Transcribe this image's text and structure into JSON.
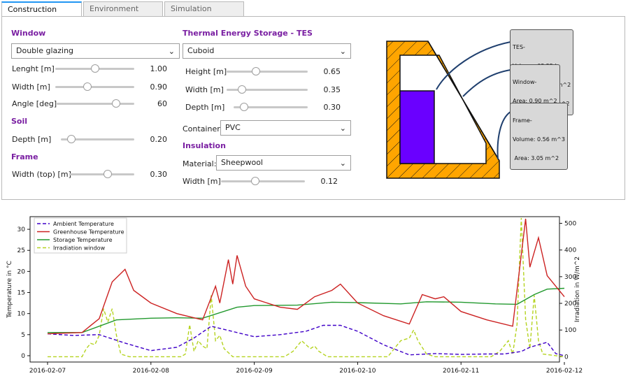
{
  "tabs": [
    {
      "label": "Construction",
      "active": true
    },
    {
      "label": "Environment",
      "active": false
    },
    {
      "label": "Simulation",
      "active": false
    }
  ],
  "window_section": {
    "title": "Window",
    "type": "Double glazing",
    "length_label": "Lenght [m]",
    "length_value": "1.00",
    "length_level": 0.5,
    "width_label": "Width [m]",
    "width_value": "0.90",
    "width_level": 0.4,
    "angle_label": "Angle [deg]",
    "angle_value": "60",
    "angle_level": 0.8
  },
  "soil_section": {
    "title": "Soil",
    "depth_label": "Depth [m]",
    "depth_value": "0.20",
    "depth_level": 0.1
  },
  "frame_section": {
    "title": "Frame",
    "width_label": "Width (top) [m]",
    "width_value": "0.30",
    "width_level": 0.6
  },
  "tes_section": {
    "title": "Thermal Energy Storage - TES",
    "shape": "Cuboid",
    "height_label": "Height [m]",
    "height_value": "0.65",
    "height_level": 0.35,
    "width_label": "Width [m]",
    "width_value": "0.35",
    "width_level": 0.15,
    "depth_label": "Depth [m]",
    "depth_value": "0.30",
    "depth_level": 0.1,
    "container_label": "Container:",
    "container_value": "PVC"
  },
  "insulation_section": {
    "title": "Insulation",
    "material_label": "Material:",
    "material_value": "Sheepwool",
    "width_label": "Width [m]",
    "width_value": "0.12",
    "width_level": 0.4
  },
  "diagram": {
    "tes_callout": [
      "TES-",
      "Volume: 68.25 L",
      "Area-abs.: 0.23 m^2",
      "Area-emi.:0.72 m^2"
    ],
    "window_callout": [
      "Window-",
      "Area: 0.90 m^2"
    ],
    "frame_callout": [
      "Frame-",
      "Volume: 0.56 m^3",
      " Area: 3.05 m^2"
    ],
    "frame_color": "#ffa500",
    "tes_color": "#6a00ff"
  },
  "chart_data": {
    "type": "line",
    "ylabel": "Temperature in °C",
    "y2label": "Irradiation in W/m^2",
    "ylim": [
      -1.5,
      33
    ],
    "y2lim": [
      -20,
      525
    ],
    "yticks": [
      0,
      5,
      10,
      15,
      20,
      25,
      30
    ],
    "y2ticks": [
      0,
      100,
      200,
      300,
      400,
      500
    ],
    "xlim": [
      "2016-02-07",
      "2016-02-12"
    ],
    "xticks": [
      "2016-02-07",
      "2016-02-08",
      "2016-02-09",
      "2016-02-10",
      "2016-02-11",
      "2016-02-12"
    ],
    "legend_position": "top-left",
    "series": [
      {
        "name": "Ambient Temperature",
        "axis": "left",
        "color": "#3f00c8",
        "style": "dashed",
        "x": [
          "2016-02-07T00:00",
          "2016-02-07T06:00",
          "2016-02-07T12:00",
          "2016-02-07T18:00",
          "2016-02-08T00:00",
          "2016-02-08T06:00",
          "2016-02-08T10:00",
          "2016-02-08T14:00",
          "2016-02-08T16:00",
          "2016-02-08T18:00",
          "2016-02-09T00:00",
          "2016-02-09T06:00",
          "2016-02-09T12:00",
          "2016-02-09T16:00",
          "2016-02-09T20:00",
          "2016-02-10T00:00",
          "2016-02-10T06:00",
          "2016-02-10T12:00",
          "2016-02-10T18:00",
          "2016-02-11T00:00",
          "2016-02-11T06:00",
          "2016-02-11T10:00",
          "2016-02-11T14:00",
          "2016-02-11T16:00",
          "2016-02-11T20:00",
          "2016-02-11T22:00",
          "2016-02-12T00:00"
        ],
        "y": [
          5.2,
          4.8,
          5.0,
          3.0,
          1.2,
          2.0,
          4.2,
          7.0,
          6.5,
          6.0,
          4.5,
          5.0,
          5.8,
          7.2,
          7.2,
          5.8,
          2.6,
          0.2,
          0.5,
          0.3,
          0.4,
          0.4,
          1.0,
          2.0,
          3.2,
          0.5,
          0.0
        ]
      },
      {
        "name": "Greenhouse Temperature",
        "axis": "left",
        "color": "#cc2222",
        "style": "solid",
        "x": [
          "2016-02-07T00:00",
          "2016-02-07T08:00",
          "2016-02-07T12:00",
          "2016-02-07T15:00",
          "2016-02-07T18:00",
          "2016-02-07T20:00",
          "2016-02-08T00:00",
          "2016-02-08T06:00",
          "2016-02-08T12:00",
          "2016-02-08T15:00",
          "2016-02-08T16:00",
          "2016-02-08T18:00",
          "2016-02-08T19:00",
          "2016-02-08T20:00",
          "2016-02-08T22:00",
          "2016-02-09T00:00",
          "2016-02-09T06:00",
          "2016-02-09T10:00",
          "2016-02-09T14:00",
          "2016-02-09T18:00",
          "2016-02-09T20:00",
          "2016-02-10T00:00",
          "2016-02-10T06:00",
          "2016-02-10T12:00",
          "2016-02-10T15:00",
          "2016-02-10T18:00",
          "2016-02-10T20:00",
          "2016-02-11T00:00",
          "2016-02-11T06:00",
          "2016-02-11T12:00",
          "2016-02-11T15:00",
          "2016-02-11T16:00",
          "2016-02-11T18:00",
          "2016-02-11T20:00",
          "2016-02-12T00:00"
        ],
        "y": [
          5.2,
          5.5,
          8.8,
          17.5,
          20.5,
          15.5,
          12.5,
          10.0,
          8.5,
          16.5,
          12.5,
          22.8,
          17.0,
          23.8,
          16.5,
          13.5,
          11.5,
          11.0,
          14.0,
          15.5,
          17.0,
          12.5,
          9.5,
          7.5,
          14.5,
          13.5,
          14.0,
          10.5,
          8.5,
          7.0,
          32.5,
          21.0,
          28.0,
          19.0,
          14.0
        ]
      },
      {
        "name": "Storage Temperature",
        "axis": "left",
        "color": "#22992e",
        "style": "solid",
        "x": [
          "2016-02-07T00:00",
          "2016-02-07T08:00",
          "2016-02-07T16:00",
          "2016-02-08T00:00",
          "2016-02-08T06:00",
          "2016-02-08T12:00",
          "2016-02-08T20:00",
          "2016-02-09T00:00",
          "2016-02-09T10:00",
          "2016-02-09T18:00",
          "2016-02-10T00:00",
          "2016-02-10T10:00",
          "2016-02-10T16:00",
          "2016-02-11T00:00",
          "2016-02-11T08:00",
          "2016-02-11T13:00",
          "2016-02-11T17:00",
          "2016-02-11T20:00",
          "2016-02-12T00:00"
        ],
        "y": [
          5.5,
          5.5,
          8.5,
          8.9,
          9.0,
          8.9,
          11.5,
          11.9,
          12.0,
          12.7,
          12.6,
          12.3,
          12.8,
          12.7,
          12.3,
          12.2,
          14.5,
          15.8,
          16.0
        ]
      },
      {
        "name": "Irradiation window",
        "axis": "right",
        "color": "#b5d320",
        "style": "dashed",
        "x": [
          "2016-02-07T00:00",
          "2016-02-07T08:00",
          "2016-02-07T09:00",
          "2016-02-07T10:00",
          "2016-02-07T11:00",
          "2016-02-07T12:00",
          "2016-02-07T13:00",
          "2016-02-07T14:00",
          "2016-02-07T15:00",
          "2016-02-07T16:00",
          "2016-02-07T17:00",
          "2016-02-07T19:00",
          "2016-02-08T07:00",
          "2016-02-08T08:00",
          "2016-02-08T09:00",
          "2016-02-08T10:00",
          "2016-02-08T11:00",
          "2016-02-08T12:00",
          "2016-02-08T13:00",
          "2016-02-08T14:00",
          "2016-02-08T15:00",
          "2016-02-08T16:00",
          "2016-02-08T17:00",
          "2016-02-08T19:00",
          "2016-02-09T07:00",
          "2016-02-09T09:00",
          "2016-02-09T11:00",
          "2016-02-09T13:00",
          "2016-02-09T14:00",
          "2016-02-09T15:00",
          "2016-02-09T17:00",
          "2016-02-10T07:00",
          "2016-02-10T08:00",
          "2016-02-10T10:00",
          "2016-02-10T12:00",
          "2016-02-10T13:00",
          "2016-02-10T14:00",
          "2016-02-10T16:00",
          "2016-02-10T18:00",
          "2016-02-11T07:00",
          "2016-02-11T09:00",
          "2016-02-11T11:00",
          "2016-02-11T12:00",
          "2016-02-11T13:00",
          "2016-02-11T14:00",
          "2016-02-11T15:00",
          "2016-02-11T16:00",
          "2016-02-11T17:00",
          "2016-02-11T18:00",
          "2016-02-11T19:00",
          "2016-02-12T00:00"
        ],
        "y": [
          0,
          0,
          30,
          50,
          45,
          80,
          180,
          130,
          180,
          80,
          10,
          0,
          0,
          10,
          120,
          20,
          60,
          40,
          30,
          230,
          60,
          80,
          30,
          0,
          0,
          20,
          60,
          30,
          40,
          20,
          0,
          0,
          20,
          60,
          70,
          100,
          60,
          10,
          0,
          0,
          20,
          60,
          10,
          120,
          520,
          140,
          30,
          230,
          60,
          10,
          0
        ]
      }
    ]
  }
}
